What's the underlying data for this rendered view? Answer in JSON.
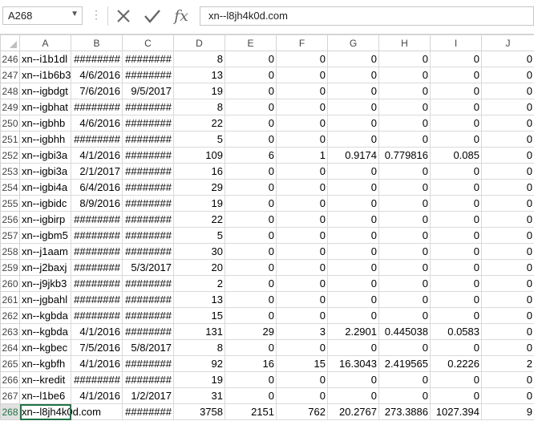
{
  "name_box": {
    "value": "A268",
    "dropdown_glyph": "▼"
  },
  "formula": {
    "dots": "⋮",
    "cancel_glyph": "✕",
    "enter_glyph": "✔",
    "fx_label": "fx",
    "value": "xn--l8jh4k0d.com"
  },
  "colors": {
    "accent": "#217346",
    "grid": "#dadada",
    "header_text": "#444444"
  },
  "columns": [
    "A",
    "B",
    "C",
    "D",
    "E",
    "F",
    "G",
    "H",
    "I",
    "J"
  ],
  "rows": [
    {
      "n": "246",
      "cells": [
        "xn--i1b1dl",
        "########",
        "########",
        "8",
        "0",
        "0",
        "0",
        "0",
        "0",
        "0"
      ]
    },
    {
      "n": "247",
      "cells": [
        "xn--i1b6b3",
        "4/6/2016",
        "########",
        "13",
        "0",
        "0",
        "0",
        "0",
        "0",
        "0"
      ]
    },
    {
      "n": "248",
      "cells": [
        "xn--igbdgt",
        "7/6/2016",
        "9/5/2017",
        "19",
        "0",
        "0",
        "0",
        "0",
        "0",
        "0"
      ]
    },
    {
      "n": "249",
      "cells": [
        "xn--igbhat",
        "########",
        "########",
        "8",
        "0",
        "0",
        "0",
        "0",
        "0",
        "0"
      ]
    },
    {
      "n": "250",
      "cells": [
        "xn--igbhb",
        "4/6/2016",
        "########",
        "22",
        "0",
        "0",
        "0",
        "0",
        "0",
        "0"
      ]
    },
    {
      "n": "251",
      "cells": [
        "xn--igbhh",
        "########",
        "########",
        "5",
        "0",
        "0",
        "0",
        "0",
        "0",
        "0"
      ]
    },
    {
      "n": "252",
      "cells": [
        "xn--igbi3a",
        "4/1/2016",
        "########",
        "109",
        "6",
        "1",
        "0.9174",
        "0.779816",
        "0.085",
        "0"
      ]
    },
    {
      "n": "253",
      "cells": [
        "xn--igbi3a",
        "2/1/2017",
        "########",
        "16",
        "0",
        "0",
        "0",
        "0",
        "0",
        "0"
      ]
    },
    {
      "n": "254",
      "cells": [
        "xn--igbi4a",
        "6/4/2016",
        "########",
        "29",
        "0",
        "0",
        "0",
        "0",
        "0",
        "0"
      ]
    },
    {
      "n": "255",
      "cells": [
        "xn--igbidc",
        "8/9/2016",
        "########",
        "19",
        "0",
        "0",
        "0",
        "0",
        "0",
        "0"
      ]
    },
    {
      "n": "256",
      "cells": [
        "xn--igbirp",
        "########",
        "########",
        "22",
        "0",
        "0",
        "0",
        "0",
        "0",
        "0"
      ]
    },
    {
      "n": "257",
      "cells": [
        "xn--igbm5",
        "########",
        "########",
        "5",
        "0",
        "0",
        "0",
        "0",
        "0",
        "0"
      ]
    },
    {
      "n": "258",
      "cells": [
        "xn--j1aam",
        "########",
        "########",
        "30",
        "0",
        "0",
        "0",
        "0",
        "0",
        "0"
      ]
    },
    {
      "n": "259",
      "cells": [
        "xn--j2baxj",
        "########",
        "5/3/2017",
        "20",
        "0",
        "0",
        "0",
        "0",
        "0",
        "0"
      ]
    },
    {
      "n": "260",
      "cells": [
        "xn--j9jkb3",
        "########",
        "########",
        "2",
        "0",
        "0",
        "0",
        "0",
        "0",
        "0"
      ]
    },
    {
      "n": "261",
      "cells": [
        "xn--jgbahl",
        "########",
        "########",
        "13",
        "0",
        "0",
        "0",
        "0",
        "0",
        "0"
      ]
    },
    {
      "n": "262",
      "cells": [
        "xn--kgbda",
        "########",
        "########",
        "15",
        "0",
        "0",
        "0",
        "0",
        "0",
        "0"
      ]
    },
    {
      "n": "263",
      "cells": [
        "xn--kgbda",
        "4/1/2016",
        "########",
        "131",
        "29",
        "3",
        "2.2901",
        "0.445038",
        "0.0583",
        "0"
      ]
    },
    {
      "n": "264",
      "cells": [
        "xn--kgbec",
        "7/5/2016",
        "5/8/2017",
        "8",
        "0",
        "0",
        "0",
        "0",
        "0",
        "0"
      ]
    },
    {
      "n": "265",
      "cells": [
        "xn--kgbfh",
        "4/1/2016",
        "########",
        "92",
        "16",
        "15",
        "16.3043",
        "2.419565",
        "0.2226",
        "2"
      ]
    },
    {
      "n": "266",
      "cells": [
        "xn--kredit",
        "########",
        "########",
        "19",
        "0",
        "0",
        "0",
        "0",
        "0",
        "0"
      ]
    },
    {
      "n": "267",
      "cells": [
        "xn--l1be6",
        "4/1/2016",
        "1/2/2017",
        "31",
        "0",
        "0",
        "0",
        "0",
        "0",
        "0"
      ]
    },
    {
      "n": "268",
      "cells": [
        "xn--l8jh4k0d.com",
        "",
        "########",
        "3758",
        "2151",
        "762",
        "20.2767",
        "273.3886",
        "1027.394",
        "9"
      ]
    }
  ],
  "selected_row": "268"
}
